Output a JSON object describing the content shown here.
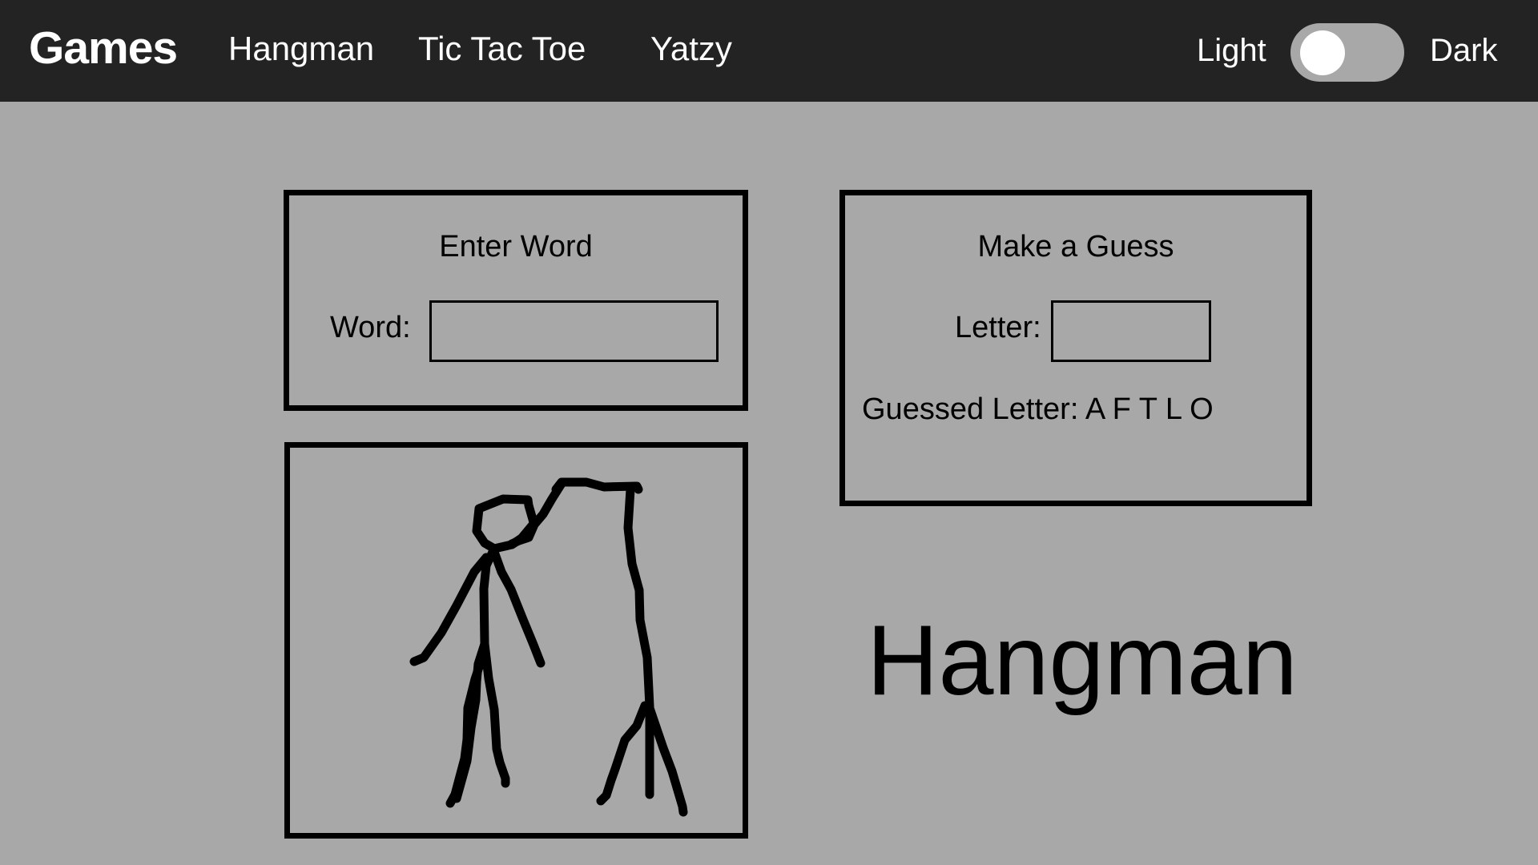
{
  "navbar": {
    "brand": "Games",
    "links": [
      "Hangman",
      "Tic Tac Toe",
      "Yatzy"
    ],
    "theme_light_label": "Light",
    "theme_dark_label": "Dark",
    "theme_toggle_state": "light"
  },
  "enter_word": {
    "title": "Enter Word",
    "word_label": "Word:",
    "word_value": ""
  },
  "make_guess": {
    "title": "Make a Guess",
    "letter_label": "Letter:",
    "letter_value": "",
    "guessed_label": "Guessed Letter:",
    "guessed_letters": "A F T L O"
  },
  "drawing": {
    "stage": "complete",
    "stroke_color": "#000000",
    "parts_drawn": [
      "gallows",
      "rope",
      "head",
      "body",
      "left-arm",
      "right-arm",
      "left-leg",
      "right-leg"
    ]
  },
  "main": {
    "game_title": "Hangman"
  },
  "colors": {
    "navbar_bg": "#232323",
    "page_bg": "#a8a8a8",
    "text": "#000000"
  }
}
